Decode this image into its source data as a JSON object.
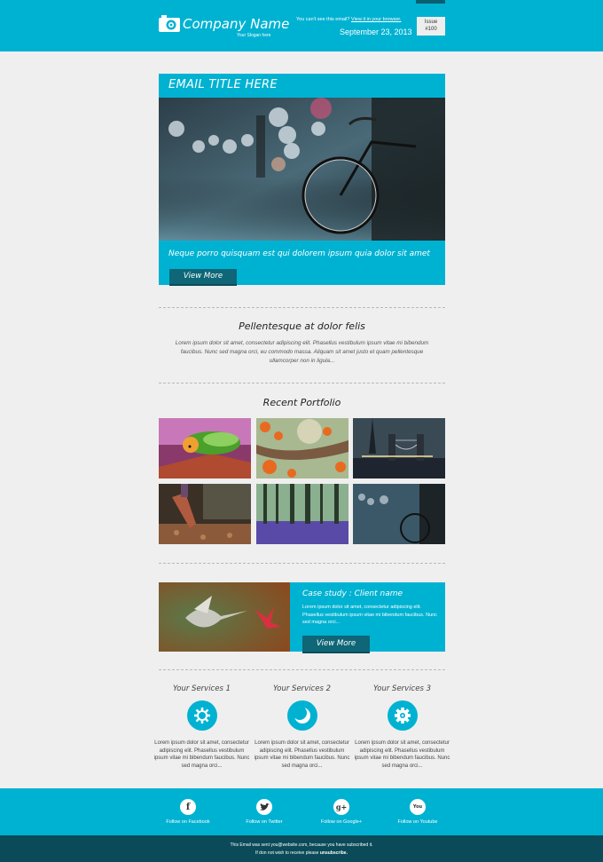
{
  "header": {
    "company_name": "Company Name",
    "slogan": "Your Slogan here",
    "cant_see_text": "You can't see this email?",
    "view_in_browser": "View it in your browser.",
    "date": "September 23, 2013",
    "issue_label": "Issue",
    "issue_number": "#100",
    "logo_icon": "camera-icon"
  },
  "hero": {
    "title": "EMAIL TITLE HERE",
    "image": "bicycle-bokeh-photo",
    "caption": "Neque porro quisquam est qui dolorem ipsum quia dolor sit amet",
    "button_label": "View More"
  },
  "intro": {
    "title": "Pellentesque at dolor felis",
    "text": "Lorem ipsum dolor sit amet, consectetur adipiscing elit. Phasellus vestibulum ipsum vitae mi bibendum faucibus. Nunc sed magna orci, eu commodo massa. Aliquam sit amet justo et quam pellentesque ullamcorper non in ligula..."
  },
  "portfolio": {
    "title": "Recent Portfolio",
    "items": [
      {
        "image": "caterpillar-photo"
      },
      {
        "image": "autumn-branch-photo"
      },
      {
        "image": "tower-bridge-photo"
      },
      {
        "image": "running-shoe-photo"
      },
      {
        "image": "bluebell-forest-photo"
      },
      {
        "image": "bicycle-street-photo"
      }
    ]
  },
  "case_study": {
    "image": "hummingbird-flower-photo",
    "title": "Case study : Client name",
    "text": "Lorem ipsum dolor sit amet, consectetur adipiscing elit. Phasellus vestibulum ipsum vitae mi bibendum faucibus. Nunc sed magna orci...",
    "button_label": "View More"
  },
  "services": [
    {
      "title": "Your Services 1",
      "icon": "sun-gear-icon",
      "text": "Lorem ipsum dolor sit amet, consectetur adipiscing elit. Phasellus vestibulum ipsum vitae mi bibendum faucibus. Nunc sed magna orci..."
    },
    {
      "title": "Your Services 2",
      "icon": "moon-icon",
      "text": "Lorem ipsum dolor sit amet, consectetur adipiscing elit. Phasellus vestibulum ipsum vitae mi bibendum faucibus. Nunc sed magna orci..."
    },
    {
      "title": "Your Services 3",
      "icon": "gear-icon",
      "text": "Lorem ipsum dolor sit amet, consectetur adipiscing elit. Phasellus vestibulum ipsum vitae mi bibendum faucibus. Nunc sed magna orci..."
    }
  ],
  "social": [
    {
      "label": "Follow on Facebook",
      "glyph": "f",
      "icon": "facebook-icon"
    },
    {
      "label": "Follow on Twitter",
      "glyph": "t",
      "icon": "twitter-icon"
    },
    {
      "label": "Follow on Google+",
      "glyph": "g+",
      "icon": "google-plus-icon"
    },
    {
      "label": "Follow on Youtube",
      "glyph": "You",
      "icon": "youtube-icon"
    }
  ],
  "footer": {
    "line1": "This Email was sent you@website.com, because you have subscribed it.",
    "line2_prefix": "If don not wish to receive please",
    "unsubscribe": "unsubscribe."
  },
  "colors": {
    "accent": "#00b2d2",
    "button": "#0e6677",
    "footer_dark": "#0b4a58",
    "background": "#efefef"
  }
}
